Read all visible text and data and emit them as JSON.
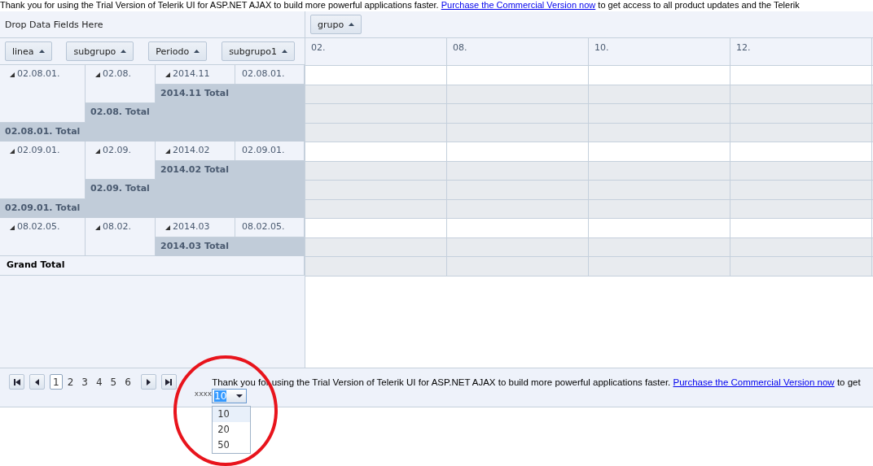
{
  "banner": {
    "text": "Thank you for using the Trial Version of Telerik UI for ASP.NET AJAX to build more powerful applications faster.",
    "link": "Purchase the Commercial Version now",
    "after": "to get access to all product updates and the Telerik"
  },
  "filter_zone": {
    "placeholder": "Drop Data Fields Here"
  },
  "column_fields": [
    {
      "label": "grupo"
    }
  ],
  "row_fields": [
    {
      "label": "linea"
    },
    {
      "label": "subgrupo"
    },
    {
      "label": "Periodo"
    },
    {
      "label": "subgrupo1"
    }
  ],
  "columns": [
    "02.",
    "08.",
    "10.",
    "12."
  ],
  "rows": [
    {
      "label": "02.08.01.",
      "expanded": true,
      "total": "02.08.01. Total",
      "children": [
        {
          "label": "02.08.",
          "expanded": true,
          "total": "02.08. Total",
          "children": [
            {
              "label": "2014.11",
              "expanded": true,
              "total": "2014.11 Total",
              "children": [
                {
                  "label": "02.08.01."
                }
              ]
            }
          ]
        }
      ]
    },
    {
      "label": "02.09.01.",
      "expanded": true,
      "total": "02.09.01. Total",
      "children": [
        {
          "label": "02.09.",
          "expanded": true,
          "total": "02.09. Total",
          "children": [
            {
              "label": "2014.02",
              "expanded": true,
              "total": "2014.02 Total",
              "children": [
                {
                  "label": "02.09.01."
                }
              ]
            }
          ]
        }
      ]
    },
    {
      "label": "08.02.05.",
      "expanded": true,
      "children": [
        {
          "label": "08.02.",
          "expanded": true,
          "children": [
            {
              "label": "2014.03",
              "expanded": true,
              "total": "2014.03 Total",
              "children": [
                {
                  "label": "08.02.05."
                }
              ]
            }
          ]
        }
      ]
    }
  ],
  "grand_total": "Grand Total",
  "pager": {
    "pages": [
      {
        "label": "1",
        "selected": true
      },
      {
        "label": "2",
        "selected": false
      },
      {
        "label": "3",
        "selected": false
      },
      {
        "label": "4",
        "selected": false
      },
      {
        "label": "5",
        "selected": false
      },
      {
        "label": "6",
        "selected": false
      }
    ],
    "page_size_label": "xxxx",
    "page_size": "10",
    "dropdown_open": true,
    "options": [
      {
        "label": "10",
        "selected": true
      },
      {
        "label": "20",
        "selected": false
      },
      {
        "label": "50",
        "selected": false
      }
    ],
    "message": "Thank you for using the Trial Version of Telerik UI for ASP.NET AJAX to build more powerful applications faster.",
    "link": "Purchase the Commercial Version now",
    "after": "to get"
  },
  "annotation": {
    "kind": "circle"
  }
}
